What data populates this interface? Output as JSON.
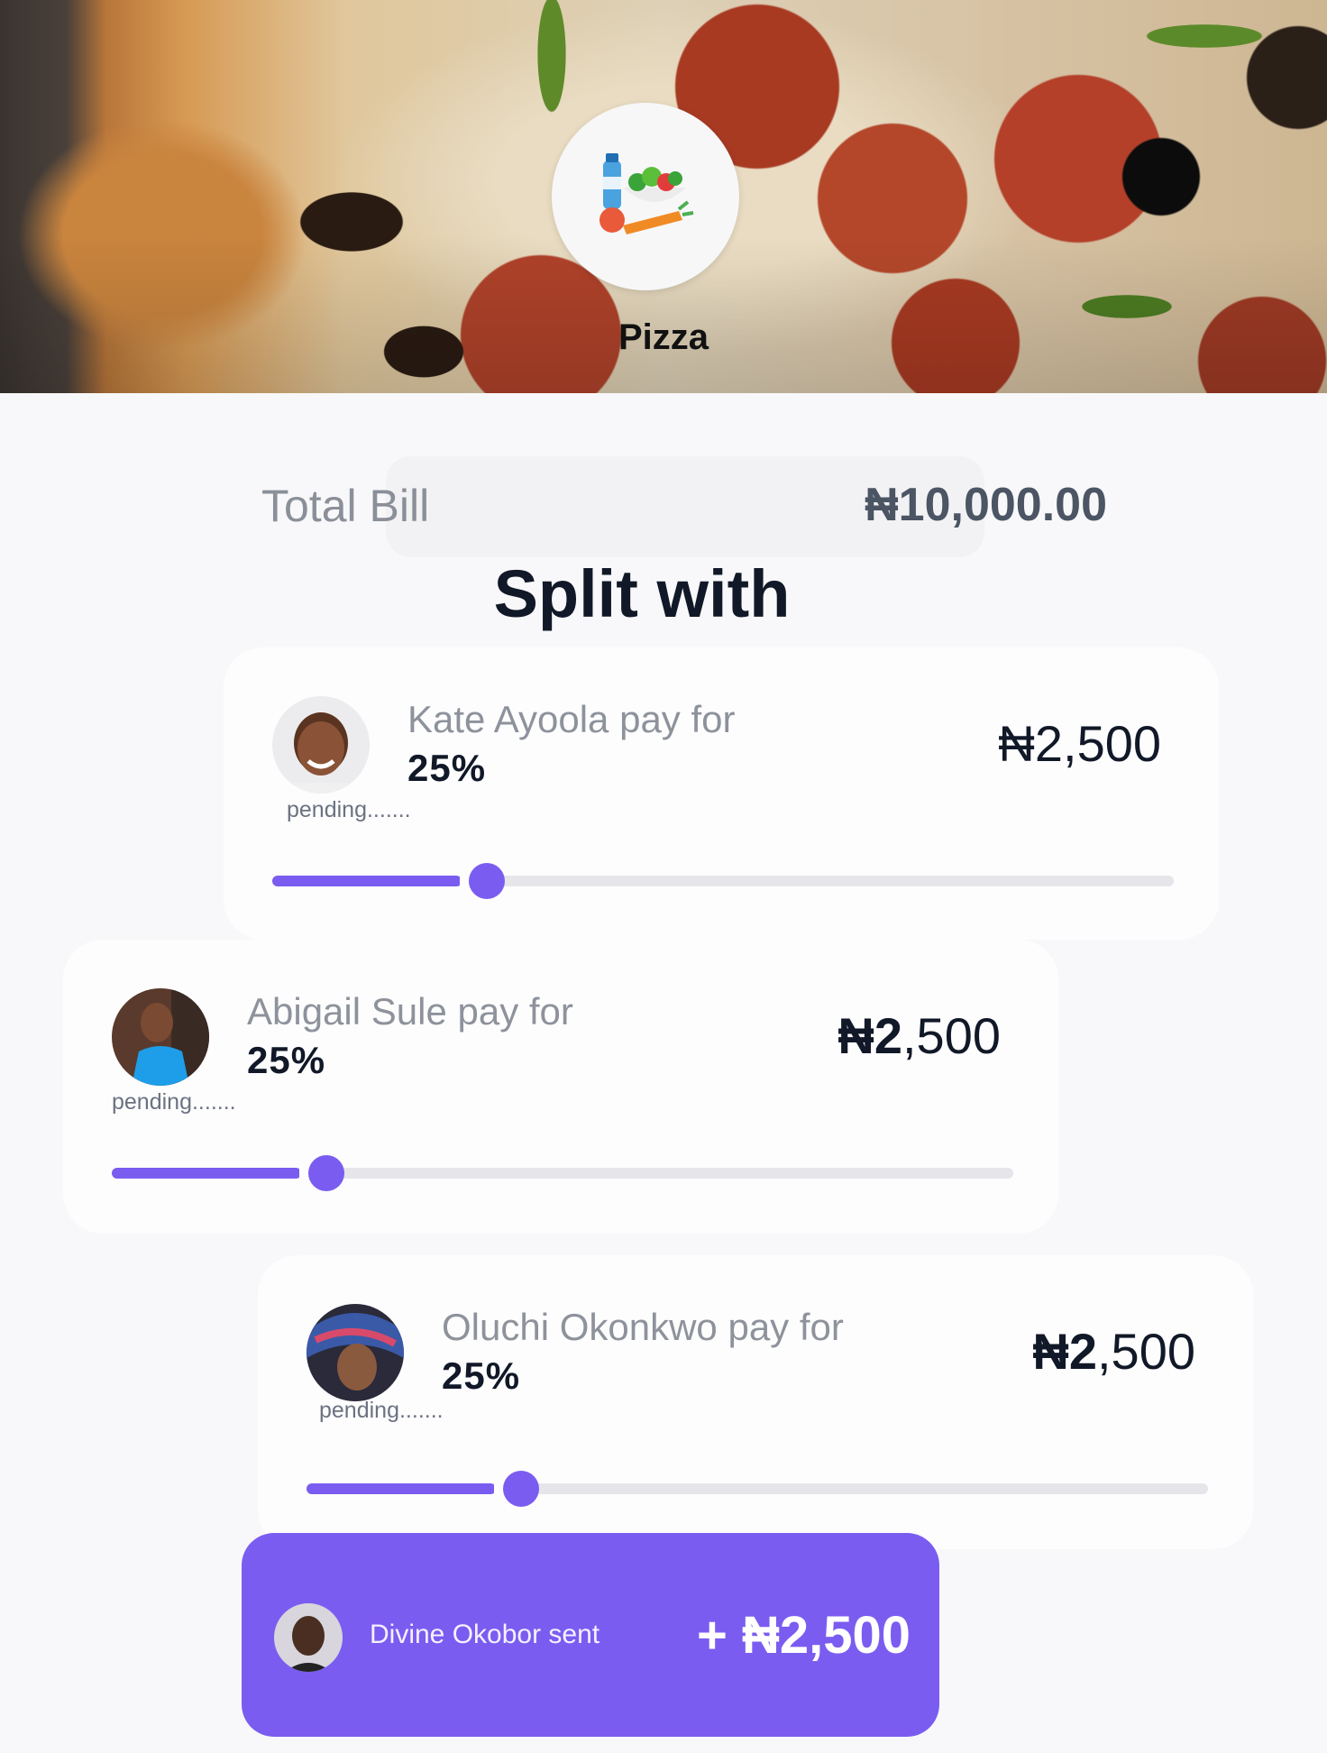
{
  "header": {
    "category_icon": "groceries-icon",
    "category_title": "Pizza"
  },
  "bill": {
    "total_label": "Total Bill",
    "total_value": "₦10,000.00"
  },
  "split_title": "Split with",
  "participants": [
    {
      "name_line": "Kate Ayoola pay for",
      "percent": "25%",
      "percent_value": 25,
      "status": "pending.......",
      "amount_currency": "₦",
      "amount_value": "2,500",
      "avatar_icon": "kate-avatar"
    },
    {
      "name_line": "Abigail Sule pay for",
      "percent": "25%",
      "percent_value": 25,
      "status": "pending.......",
      "amount_currency": "₦2",
      "amount_value": ",500",
      "avatar_icon": "abigail-avatar"
    },
    {
      "name_line": "Oluchi Okonkwo pay for",
      "percent": "25%",
      "percent_value": 25,
      "status": "pending.......",
      "amount_currency": "₦2",
      "amount_value": ",500",
      "avatar_icon": "oluchi-avatar"
    }
  ],
  "sent": {
    "label": "Divine Okobor sent",
    "amount": "+ ₦2,500",
    "avatar_icon": "divine-avatar"
  },
  "colors": {
    "accent": "#7b5cf0",
    "track": "#e6e6ea",
    "background": "#f8f8fa"
  }
}
